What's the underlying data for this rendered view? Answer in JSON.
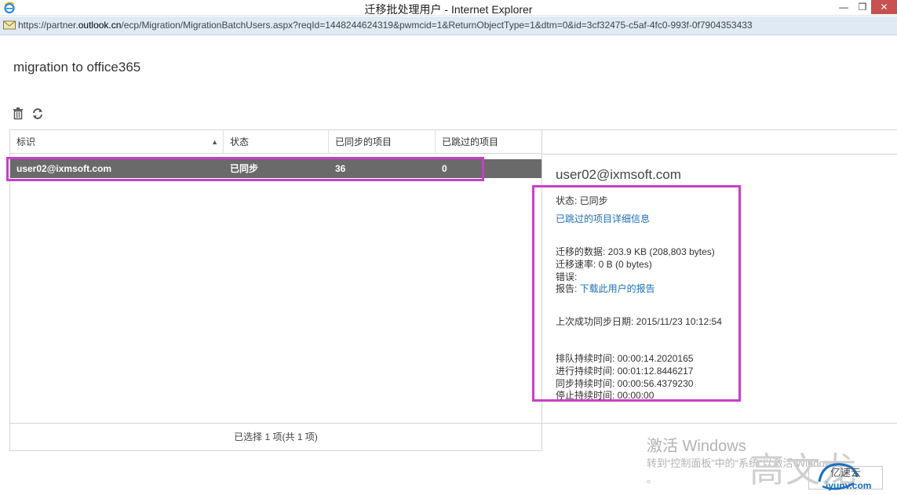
{
  "window": {
    "title": "迁移批处理用户 - Internet Explorer",
    "min_glyph": "—",
    "max_glyph": "❐",
    "close_glyph": "✕"
  },
  "address": {
    "prefix": "https://partner.",
    "host": "outlook.cn",
    "rest": "/ecp/Migration/MigrationBatchUsers.aspx?reqId=1448244624319&pwmcid=1&ReturnObjectType=1&dtm=0&id=3cf32475-c5af-4fc0-993f-0f7904353433"
  },
  "page": {
    "title": "migration to office365"
  },
  "toolbar": {
    "delete_icon": "trash-icon",
    "refresh_icon": "refresh-icon"
  },
  "table": {
    "columns": [
      "标识",
      "状态",
      "已同步的项目",
      "已跳过的项目"
    ],
    "sort_glyph": "▲",
    "rows": [
      {
        "id": "user02@ixmsoft.com",
        "status": "已同步",
        "synced": "36",
        "skipped": "0"
      }
    ],
    "footer": "已选择 1 项(共 1 项)"
  },
  "detail": {
    "user": "user02@ixmsoft.com",
    "status_line": "状态: 已同步",
    "skipped_link": "已跳过的项目详细信息",
    "migrated_data": "迁移的数据: 203.9 KB (208,803 bytes)",
    "migration_rate": "迁移速率: 0 B (0 bytes)",
    "error": "错误:",
    "report_label": "报告: ",
    "report_link": "下载此用户的报告",
    "last_sync": "上次成功同步日期: 2015/11/23 10:12:54",
    "queued": "排队持续时间: 00:00:14.2020165",
    "in_progress": "进行持续时间: 00:01:12.8446217",
    "synced": "同步持续时间: 00:00:56.4379230",
    "stopped": "停止持续时间: 00:00:00"
  },
  "overlay": {
    "activate_title": "激活 Windows",
    "activate_sub": "转到“控制面板”中的“系统”以激活 Windows",
    "activate_dot": "。",
    "watermark": "高文龙",
    "site_name": "亿速云",
    "site_url": "iyunv.com",
    "close_label": "关闭"
  },
  "colors": {
    "selection_row": "#6a6a6a",
    "highlight_box": "#c840c8",
    "link": "#1e6fb5",
    "address_bar": "#dfeaf4"
  }
}
